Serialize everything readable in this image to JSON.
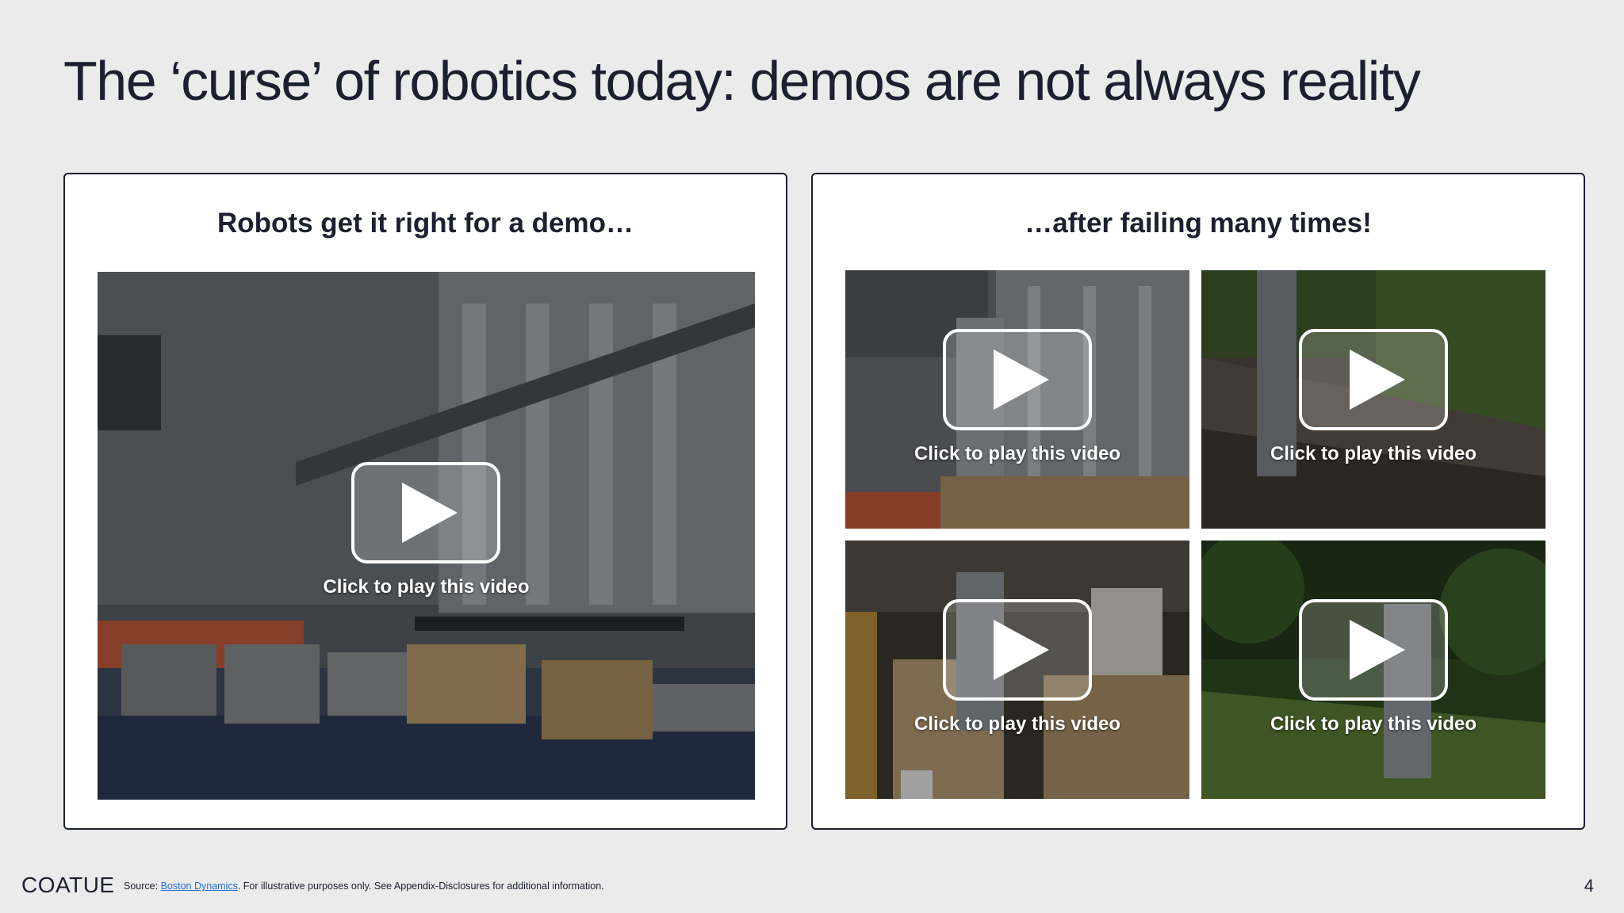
{
  "slide": {
    "title": "The ‘curse’ of robotics today: demos are not always reality",
    "page_number": "4"
  },
  "left_panel": {
    "heading": "Robots get it right for a demo…",
    "video": {
      "caption": "Click to play this video",
      "icon": "play-icon"
    }
  },
  "right_panel": {
    "heading": "…after failing many times!",
    "videos": [
      {
        "caption": "Click to play this video",
        "icon": "play-icon"
      },
      {
        "caption": "Click to play this video",
        "icon": "play-icon"
      },
      {
        "caption": "Click to play this video",
        "icon": "play-icon"
      },
      {
        "caption": "Click to play this video",
        "icon": "play-icon"
      }
    ]
  },
  "footer": {
    "logo": "COATUE",
    "source_prefix": "Source: ",
    "source_link": "Boston Dynamics",
    "source_suffix": ". For illustrative purposes only. See Appendix-Disclosures for additional information."
  },
  "colors": {
    "background": "#ebebeb",
    "text": "#1c1f2e",
    "link": "#2a6bd8",
    "panel_border": "#1c1f2e"
  }
}
